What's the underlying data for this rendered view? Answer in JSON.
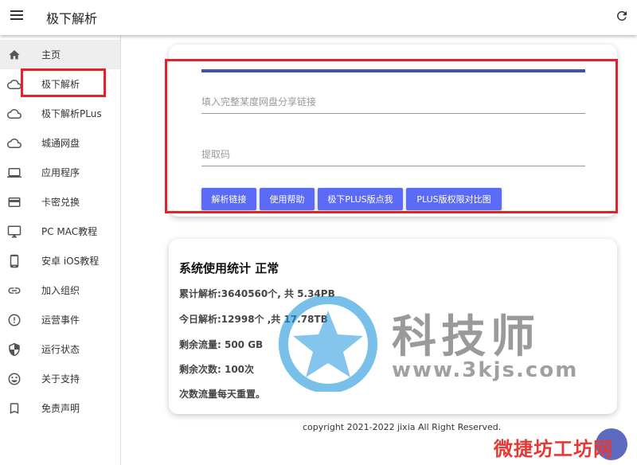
{
  "app": {
    "title": "极下解析"
  },
  "sidebar": {
    "items": [
      {
        "label": "主页",
        "icon": "home-icon"
      },
      {
        "label": "极下解析",
        "icon": "cloud-icon"
      },
      {
        "label": "极下解析PLus",
        "icon": "cloud-icon"
      },
      {
        "label": "城通网盘",
        "icon": "cloud-icon"
      },
      {
        "label": "应用程序",
        "icon": "laptop-icon"
      },
      {
        "label": "卡密兑换",
        "icon": "card-icon"
      },
      {
        "label": "PC MAC教程",
        "icon": "monitor-icon"
      },
      {
        "label": "安卓 iOS教程",
        "icon": "phone-icon"
      },
      {
        "label": "加入组织",
        "icon": "link-icon"
      },
      {
        "label": "运营事件",
        "icon": "alert-icon"
      },
      {
        "label": "运行状态",
        "icon": "shield-icon"
      },
      {
        "label": "关于支持",
        "icon": "smile-icon"
      },
      {
        "label": "免责声明",
        "icon": "bookmark-icon"
      }
    ]
  },
  "form": {
    "link_placeholder": "填入完整某度网盘分享链接",
    "code_placeholder": "提取码",
    "buttons": {
      "parse": "解析链接",
      "help": "使用帮助",
      "plus": "极下PLUS版点我",
      "compare": "PLUS版权限对比图"
    }
  },
  "stats": {
    "title": "系统使用统计  正常",
    "total": "累计解析:3640560个, 共 5.34PB",
    "today": "今日解析:12998个 ,共 17.78TB",
    "traffic": "剩余流量: 500 GB",
    "count": "剩余次数: 100次",
    "reset": "次数流量每天重置。"
  },
  "footer": {
    "copyright": "copyright 2021-2022 jixia All Right Reserved."
  },
  "watermark": {
    "text": "科技师",
    "url": "www.3kjs.com",
    "bottom": "微捷坊工坊网"
  },
  "colors": {
    "accent": "#5c6bf5",
    "progress": "#3f51b5",
    "highlight": "#e0242b"
  }
}
